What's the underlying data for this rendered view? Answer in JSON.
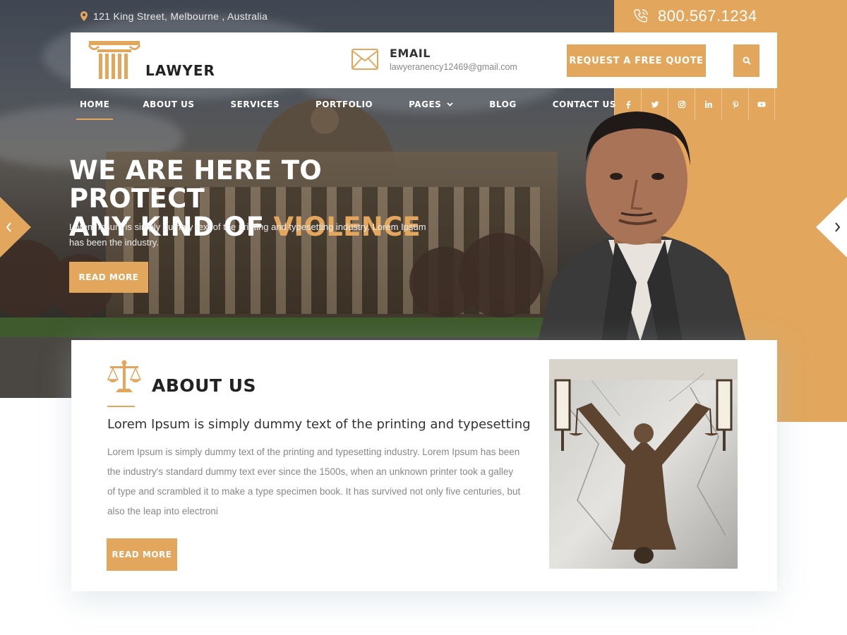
{
  "topbar": {
    "address": "121 King Street, Melbourne , Australia",
    "phone": "800.567.1234"
  },
  "header": {
    "logo_text": "LAWYER",
    "email_title": "EMAIL",
    "email_value": "lawyeranency12469@gmail.com",
    "quote_button": "REQUEST A FREE QUOTE"
  },
  "nav": {
    "items": [
      {
        "label": "HOME",
        "active": true
      },
      {
        "label": "ABOUT US"
      },
      {
        "label": "SERVICES"
      },
      {
        "label": "PORTFOLIO"
      },
      {
        "label": "PAGES",
        "dropdown": true
      },
      {
        "label": "BLOG"
      },
      {
        "label": "CONTACT US"
      }
    ]
  },
  "social": [
    "facebook-icon",
    "twitter-icon",
    "instagram-icon",
    "linkedin-icon",
    "pinterest-icon",
    "youtube-icon"
  ],
  "hero": {
    "title_line1": "WE ARE HERE TO PROTECT",
    "title_line2_prefix": "ANY KIND OF ",
    "title_line2_accent": "VIOLENCE",
    "description": "Lorem Ipsum is simply dummy text of the printing and typesetting industry. Lorem Ipsum has been the industry.",
    "button": "READ MORE"
  },
  "about": {
    "title": "ABOUT US",
    "subtitle": "Lorem Ipsum is simply dummy text of the printing and typesetting",
    "body": "Lorem Ipsum is simply dummy text of the printing and typesetting industry. Lorem Ipsum has been the industry's standard dummy text ever since the 1500s, when an unknown printer took a galley of type and scrambled it to make a type specimen book. It has survived not only five centuries, but also the leap into electroni",
    "button": "READ MORE"
  },
  "colors": {
    "accent": "#e2a75d",
    "dark_text": "#222222",
    "muted_text": "#888888"
  }
}
